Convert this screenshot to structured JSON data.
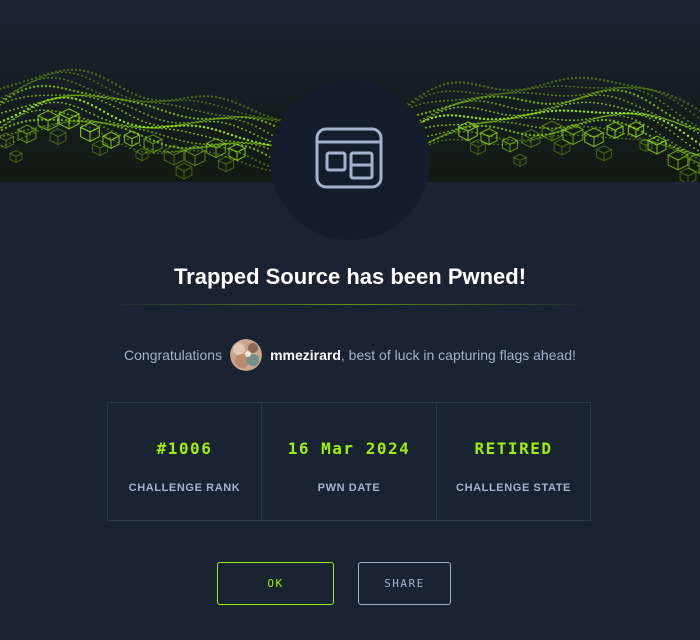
{
  "banner": {
    "icon": "green-digital-cube-wave"
  },
  "challenge": {
    "icon": "browser-window-icon",
    "title": "Trapped Source has been Pwned!"
  },
  "congrats": {
    "lead": "Congratulations",
    "username": "mmezirard",
    "tail": ", best of luck in capturing flags ahead!"
  },
  "stats": {
    "rank": {
      "value": "#1006",
      "label": "CHALLENGE RANK"
    },
    "date": {
      "value": "16 Mar 2024",
      "label": "PWN DATE"
    },
    "state": {
      "value": "RETIRED",
      "label": "CHALLENGE STATE"
    }
  },
  "buttons": {
    "ok": "OK",
    "share": "SHARE"
  },
  "colors": {
    "background": "#1a2332",
    "accent": "#9fef00",
    "muted": "#a4b1cd",
    "circle": "#141d2b"
  }
}
